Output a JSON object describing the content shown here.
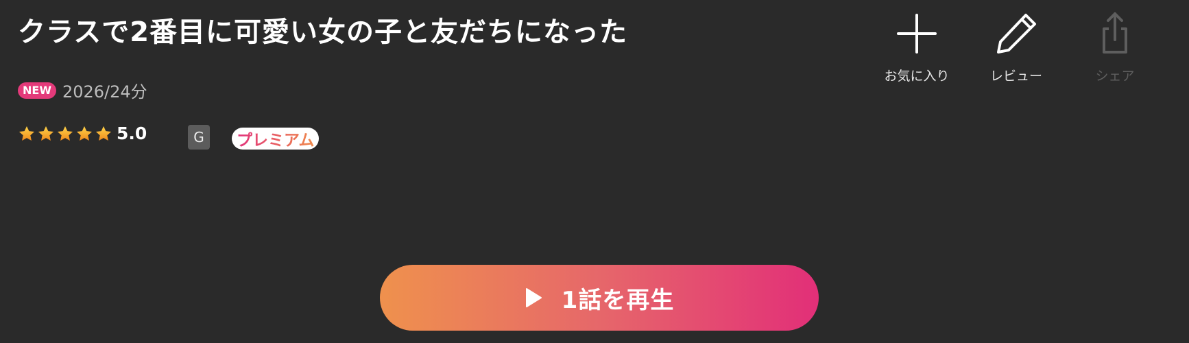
{
  "title": "クラスで2番目に可愛い女の子と友だちになった",
  "meta": {
    "new_badge": "NEW",
    "year_duration": "2026/24分"
  },
  "rating": {
    "value": "5.0",
    "stars": 5,
    "star_color": "#f5a623"
  },
  "age_rating": "G",
  "premium_label": "プレミアム",
  "actions": {
    "favorite": {
      "label": "お気に入り",
      "icon": "plus-icon"
    },
    "review": {
      "label": "レビュー",
      "icon": "pencil-icon"
    },
    "share": {
      "label": "シェア",
      "icon": "share-icon",
      "disabled": true
    }
  },
  "play_button": {
    "label": "1話を再生",
    "icon": "play-icon"
  },
  "colors": {
    "background": "#2a2a2a",
    "accent_pink": "#e43a7a",
    "accent_orange": "#ef914d"
  }
}
